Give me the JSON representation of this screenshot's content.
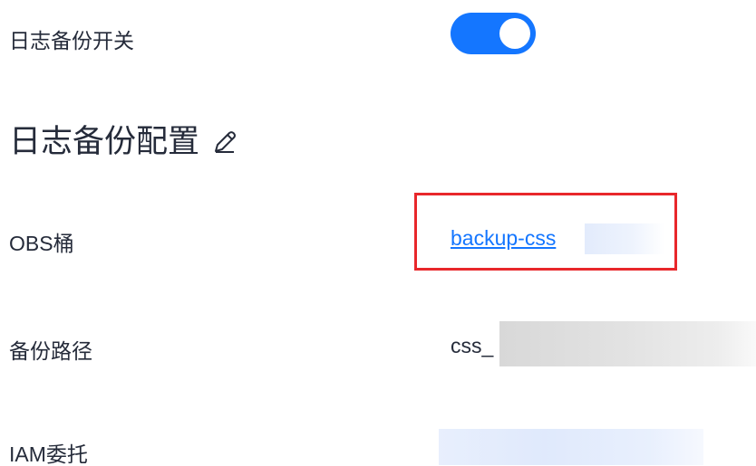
{
  "backup_switch": {
    "label": "日志备份开关",
    "enabled": true,
    "accent_color": "#1476ff"
  },
  "backup_config": {
    "title": "日志备份配置",
    "edit_icon": "pencil-icon"
  },
  "fields": {
    "obs_bucket": {
      "label": "OBS桶",
      "value": "backup-css",
      "link_color": "#1476ff"
    },
    "backup_path": {
      "label": "备份路径",
      "value": "css_"
    },
    "iam_agency": {
      "label": "IAM委托"
    }
  },
  "highlight_color": "#e8272b"
}
